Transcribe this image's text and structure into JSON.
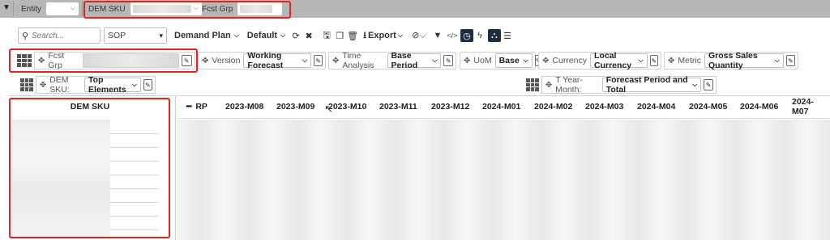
{
  "topbar": {
    "entity_label": "Entity",
    "dem_sku_label": "DEM SKU",
    "fcst_grp_label": "Fcst Grp"
  },
  "toolbar": {
    "search_placeholder": "Search...",
    "sop_value": "SOP",
    "demand_plan_label": "Demand Plan",
    "default_label": "Default",
    "export_label": "Export"
  },
  "filters": {
    "fcst_grp_label": "Fcst Grp",
    "version_label": "Version",
    "version_value": "Working Forecast",
    "time_analysis_label": "Time Analysis",
    "time_analysis_value": "Base Period",
    "uom_label": "UoM",
    "uom_value": "Base",
    "currency_label": "Currency",
    "currency_value": "Local Currency",
    "metric_label": "Metric",
    "metric_value": "Gross Sales Quantity"
  },
  "row_axis": {
    "dem_sku_label": "DEM SKU:",
    "dem_sku_value": "Top Elements"
  },
  "col_axis": {
    "label": "T Year-Month:",
    "value": "Forecast Period and Total"
  },
  "table": {
    "row_header": "DEM SKU",
    "rp_label": "RP",
    "columns": [
      "2023-M08",
      "2023-M09",
      "2023-M10",
      "2023-M11",
      "2023-M12",
      "2024-M01",
      "2024-M02",
      "2024-M03",
      "2024-M04",
      "2024-M05",
      "2024-M06",
      "2024-M07"
    ]
  },
  "colors": {
    "highlight": "#e02424",
    "topbar_bg": "#b7b7b7",
    "active_icon": "#1f2d3d"
  }
}
